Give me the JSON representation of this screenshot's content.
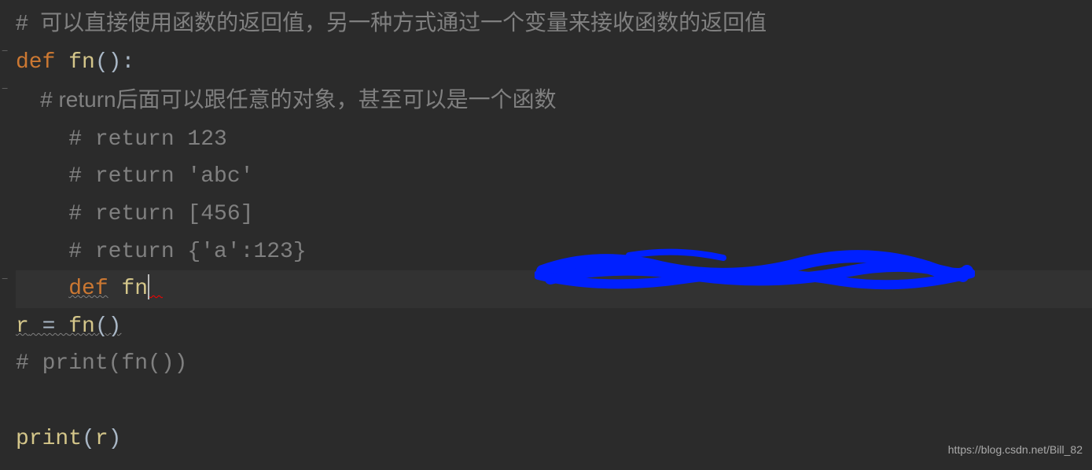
{
  "lines": {
    "l1_comment": "#  可以直接使用函数的返回值，另一种方式通过一个变量来接收函数的返回值",
    "l2_def": "def",
    "l2_fn": "fn",
    "l2_parens": "():",
    "l3_comment": "    # return后面可以跟任意的对象，甚至可以是一个函数",
    "l4_comment": "    # return 123",
    "l5_comment": "    # return 'abc'",
    "l6_comment": "    # return [456]",
    "l7_comment": "    # return {'a':123}",
    "l8_indent": "    ",
    "l8_def": "def",
    "l8_fn": "fn",
    "l9_r": "r",
    "l9_eq": " = ",
    "l9_fn": "fn",
    "l9_call": "()",
    "l10_comment": "# print(fn())",
    "l11_blank": "",
    "l12_print": "print",
    "l12_open": "(",
    "l12_r": "r",
    "l12_close": ")"
  },
  "watermark": "https://blog.csdn.net/Bill_82"
}
